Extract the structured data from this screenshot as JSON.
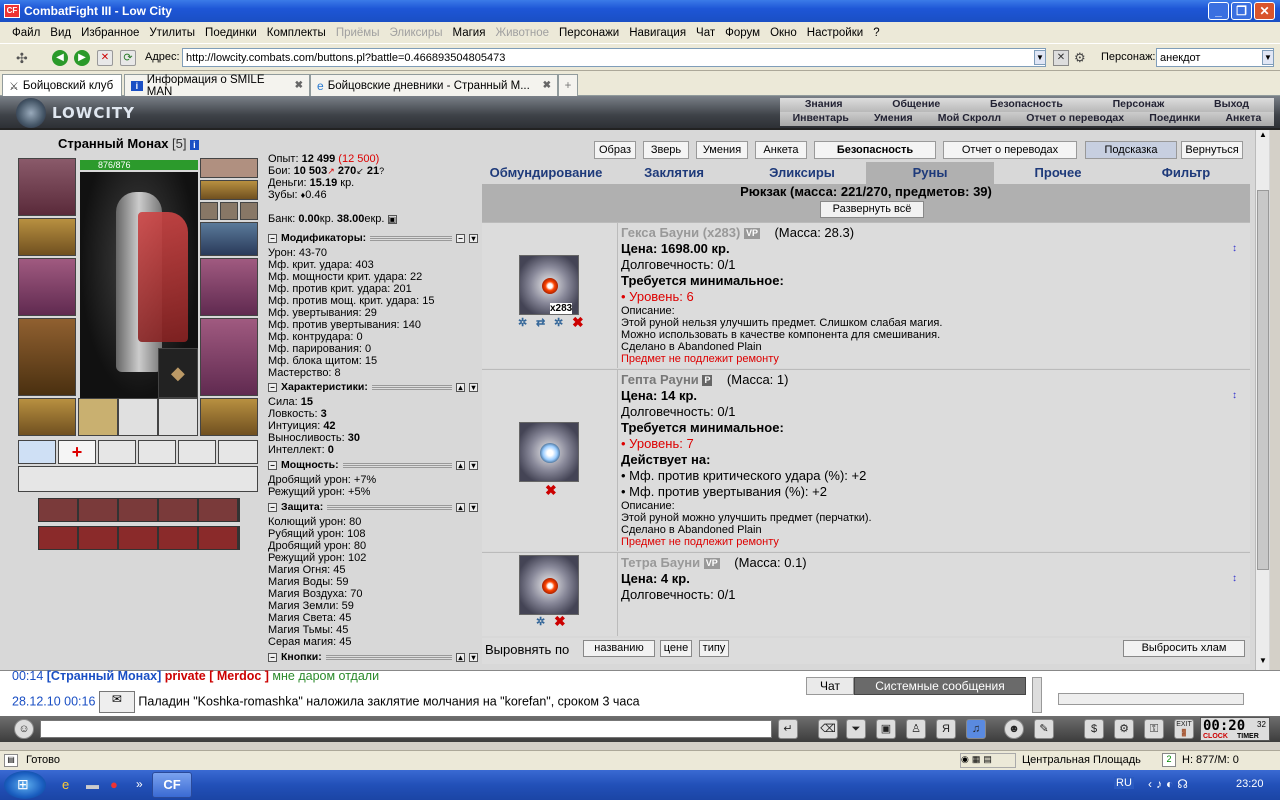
{
  "window": {
    "title": "CombatFight III - Low City"
  },
  "menu": {
    "items": [
      "Файл",
      "Вид",
      "Избранное",
      "Утилиты",
      "Поединки",
      "Комплекты",
      "Приёмы",
      "Эликсиры",
      "Магия",
      "Животное",
      "Персонажи",
      "Навигация",
      "Чат",
      "Форум",
      "Окно",
      "Настройки",
      "?"
    ],
    "disabled": [
      6,
      7,
      9
    ]
  },
  "address": {
    "label": "Адрес:",
    "value": "http://lowcity.combats.com/buttons.pl?battle=0.466893504805473",
    "persona_label": "Персонаж:",
    "persona_value": "анекдот"
  },
  "tabs": [
    {
      "label": "Бойцовский клуб"
    },
    {
      "label": "Информация о SMILE MAN"
    },
    {
      "label": "Бойцовские дневники - Странный М..."
    }
  ],
  "game": {
    "logo": "LOWCITY",
    "topnav1": [
      "Знания",
      "Общение",
      "Безопасность",
      "Персонаж",
      "Выход"
    ],
    "topnav2": [
      "Инвентарь",
      "Умения",
      "Мой Скролл",
      "Отчет о переводах",
      "Поединки",
      "Анкета"
    ]
  },
  "character": {
    "name": "Странный Монах",
    "level": "[5]",
    "hp": "876/876",
    "exp_label": "Опыт:",
    "exp": "12 499",
    "exp_next": "(12 500)",
    "fights_label": "Бои:",
    "wins": "10 503",
    "losses": "270",
    "draws": "21",
    "money_label": "Деньги:",
    "money": "15.19",
    "money_unit": "кр.",
    "teeth_label": "Зубы:",
    "teeth": "0.46",
    "bank_label": "Банк:",
    "bank_kr": "0.00",
    "bank_ekr": "38.00",
    "kr": "кр.",
    "ekr": "екр."
  },
  "sections": {
    "mods": {
      "title": "Модификаторы:",
      "lines": [
        "Урон: 43-70",
        "Мф. крит. удара: 403",
        "Мф. мощности крит. удара: 22",
        "Мф. против крит. удара: 201",
        "Мф. против мощ. крит. удара: 15",
        "Мф. увертывания: 29",
        "Мф. против увертывания: 140",
        "Мф. контрудара: 0",
        "Мф. парирования: 0",
        "Мф. блока щитом: 15",
        "Мастерство: 8"
      ]
    },
    "chars": {
      "title": "Характеристики:",
      "lines": [
        [
          "Сила:",
          "15"
        ],
        [
          "Ловкость:",
          "3"
        ],
        [
          "Интуиция:",
          "42"
        ],
        [
          "Выносливость:",
          "30"
        ],
        [
          "Интеллект:",
          "0"
        ]
      ]
    },
    "power": {
      "title": "Мощность:",
      "lines": [
        "Дробящий урон: +7%",
        "Режущий урон: +5%"
      ]
    },
    "defense": {
      "title": "Защита:",
      "lines": [
        "Колющий урон: 80",
        "Рубящий урон: 108",
        "Дробящий урон: 80",
        "Режущий урон: 102",
        "Магия Огня: 45",
        "Магия Воды: 59",
        "Магия Воздуха: 70",
        "Магия Земли: 59",
        "Магия Света: 45",
        "Магия Тьмы: 45",
        "Серая магия: 45"
      ]
    },
    "buttons": {
      "title": "Кнопки:"
    }
  },
  "toolbar": [
    "Образ",
    "Зверь",
    "Умения",
    "Анкета",
    "Безопасность",
    "Отчет о переводах",
    "Подсказка",
    "Вернуться"
  ],
  "invtabs": [
    "Обмундирование",
    "Заклятия",
    "Эликсиры",
    "Руны",
    "Прочее",
    "Фильтр"
  ],
  "backpack": {
    "title": "Рюкзак (масса: 221/270, предметов: 39)",
    "expand": "Развернуть всё"
  },
  "items": [
    {
      "name": "Гекса Бауни (x283)",
      "badge": "VP",
      "mass": "(Масса: 28.3)",
      "count": "x283",
      "price": "Цена: 1698.00 кр.",
      "durability": "Долговечность: 0/1",
      "req": "Требуется минимальное:",
      "level": "• Уровень: 6",
      "desc_label": "Описание:",
      "desc": [
        "Этой руной нельзя улучшить предмет. Слишком слабая магия.",
        "Можно использовать в качестве компонента для смешивания.",
        "Сделано в Abandoned Plain"
      ],
      "repair": "Предмет не подлежит ремонту"
    },
    {
      "name": "Гепта Рауни",
      "badge": "P",
      "mass": "(Масса: 1)",
      "price": "Цена: 14 кр.",
      "durability": "Долговечность: 0/1",
      "req": "Требуется минимальное:",
      "level": "• Уровень: 7",
      "acts": "Действует на:",
      "effects": [
        "• Мф. против критического удара (%): +2",
        "• Мф. против увертывания (%): +2"
      ],
      "desc_label": "Описание:",
      "desc": [
        "Этой руной можно улучшить предмет (перчатки).",
        "Сделано в Abandoned Plain"
      ],
      "repair": "Предмет не подлежит ремонту"
    },
    {
      "name": "Тетра Бауни",
      "badge": "VP",
      "mass": "(Масса: 0.1)",
      "price": "Цена: 4 кр.",
      "durability": "Долговечность: 0/1"
    }
  ],
  "sort": {
    "label": "Выровнять по",
    "by_name": "названию",
    "by_price": "цене",
    "by_type": "типу",
    "drop": "Выбросить хлам"
  },
  "chat": {
    "line1_time": "00:14",
    "line1_name": "[Странный Монах]",
    "line1_private": "private [ Merdoc ]",
    "line1_text": "мне даром отдали",
    "line2_time": "28.12.10 00:16",
    "line2_text": "Паладин \"Koshka-romashka\" наложила заклятие молчания на \"korefan\", сроком 3 часа",
    "tab_chat": "Чат",
    "tab_sys": "Системные сообщения"
  },
  "bottom": {
    "clock": "00:20",
    "clock_sec": "32",
    "clock_label": "CLOCK",
    "timer_label": "TIMER",
    "exit": "EXIT"
  },
  "status": {
    "text": "Готово",
    "location": "Центральная Площадь",
    "hp": "Н: 877/М: 0"
  },
  "taskbar": {
    "app": "CF",
    "lang": "RU",
    "time": "23:20"
  }
}
